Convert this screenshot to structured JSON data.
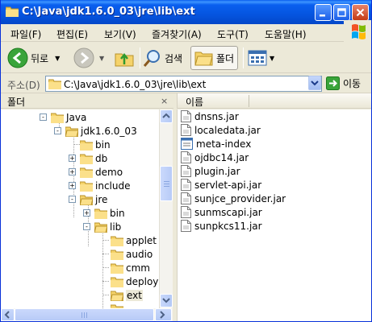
{
  "window": {
    "title": "C:\\Java\\jdk1.6.0_03\\jre\\lib\\ext"
  },
  "menu": {
    "items": [
      "파일(F)",
      "편집(E)",
      "보기(V)",
      "즐겨찾기(A)",
      "도구(T)",
      "도움말(H)"
    ]
  },
  "toolbar": {
    "back_label": "뒤로",
    "search_label": "검색",
    "folders_label": "폴더"
  },
  "address": {
    "label": "주소(D)",
    "value": "C:\\Java\\jdk1.6.0_03\\jre\\lib\\ext",
    "go_label": "이동"
  },
  "folders_pane": {
    "header": "폴더",
    "close": "×",
    "tree": [
      {
        "label": "Java",
        "toggle": "-"
      },
      {
        "label": "jdk1.6.0_03",
        "toggle": "-"
      },
      {
        "label": "bin",
        "toggle": ""
      },
      {
        "label": "db",
        "toggle": "+"
      },
      {
        "label": "demo",
        "toggle": "+"
      },
      {
        "label": "include",
        "toggle": "+"
      },
      {
        "label": "jre",
        "toggle": "-"
      },
      {
        "label": "bin",
        "toggle": "+"
      },
      {
        "label": "lib",
        "toggle": "-"
      },
      {
        "label": "applet",
        "toggle": ""
      },
      {
        "label": "audio",
        "toggle": ""
      },
      {
        "label": "cmm",
        "toggle": ""
      },
      {
        "label": "deploy",
        "toggle": ""
      },
      {
        "label": "ext",
        "toggle": "",
        "selected": true
      }
    ]
  },
  "file_pane": {
    "column_name": "이름",
    "files": [
      {
        "name": "dnsns.jar",
        "icon": "jar-file-icon"
      },
      {
        "name": "localedata.jar",
        "icon": "jar-file-icon"
      },
      {
        "name": "meta-index",
        "icon": "generic-file-icon"
      },
      {
        "name": "ojdbc14.jar",
        "icon": "jar-file-icon"
      },
      {
        "name": "plugin.jar",
        "icon": "jar-file-icon"
      },
      {
        "name": "servlet-api.jar",
        "icon": "jar-file-icon"
      },
      {
        "name": "sunjce_provider.jar",
        "icon": "jar-file-icon"
      },
      {
        "name": "sunmscapi.jar",
        "icon": "jar-file-icon"
      },
      {
        "name": "sunpkcs11.jar",
        "icon": "jar-file-icon"
      }
    ]
  },
  "colors": {
    "titlebar": "#0555e0",
    "chrome": "#ece9d8",
    "folder": "#f5d36a",
    "selection": "#ece9d8"
  }
}
